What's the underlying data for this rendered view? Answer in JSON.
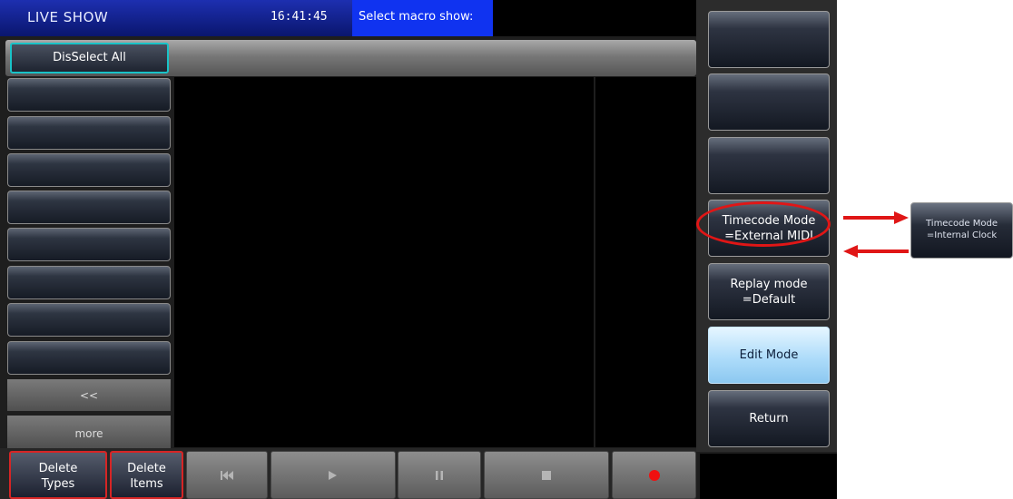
{
  "titlebar": {
    "title": "LIVE SHOW",
    "time": "16:41:45",
    "prompt": "Select macro show:"
  },
  "header": {
    "deselect_label": "DisSelect All"
  },
  "sidebar": {
    "back_label": "<<",
    "more_label": "more"
  },
  "bottombar": {
    "delete_types": [
      "Delete",
      "Types"
    ],
    "delete_items": [
      "Delete",
      "Items"
    ],
    "transport": [
      "skip-back-icon",
      "play-icon",
      "pause-icon",
      "stop-icon",
      "record-icon"
    ]
  },
  "rightpanel": {
    "timecode": [
      "Timecode Mode",
      "=External MIDI"
    ],
    "replay": [
      "Replay mode",
      "=Default"
    ],
    "edit_mode": "Edit Mode",
    "return_label": "Return"
  },
  "callout": {
    "alt_state": [
      "Timecode Mode",
      "=Internal Clock"
    ]
  },
  "colors": {
    "title_bar": "#0a166e",
    "prompt_bg": "#1033f0",
    "highlight": "#e01616",
    "active_button": "#aedcfa",
    "selected_border": "#19c3c8"
  }
}
